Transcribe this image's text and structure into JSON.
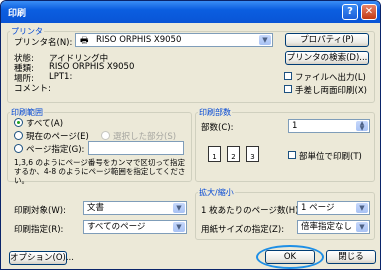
{
  "window": {
    "title": "印刷",
    "help_label": "?",
    "close_label": "✕"
  },
  "printer": {
    "group_label": "プリンタ",
    "name_label": "プリンタ名(N):",
    "name_value": "RISO ORPHIS X9050",
    "properties_button": "プロパティ(P)",
    "find_button": "プリンタの検索(D)...",
    "status_label": "状態:",
    "status_value": "アイドリング中",
    "type_label": "種類:",
    "type_value": "RISO ORPHIS X9050",
    "location_label": "場所:",
    "location_value": "LPT1:",
    "comment_label": "コメント:",
    "comment_value": "",
    "print_to_file_label": "ファイルへ出力(L)",
    "manual_duplex_label": "手差し両面印刷(X)"
  },
  "page_range": {
    "group_label": "印刷範囲",
    "all_label": "すべて(A)",
    "current_label": "現在のページ(E)",
    "selection_label": "選択した部分(S)",
    "pages_label": "ページ指定(G):",
    "pages_value": "",
    "hint": "1,3,6 のようにページ番号をカンマで区切って指定するか、4-8 のようにページ範囲を指定してください。"
  },
  "copies": {
    "group_label": "印刷部数",
    "count_label": "部数(C):",
    "count_value": "1",
    "collate_label": "部単位で印刷(T)",
    "page_icons": [
      "1",
      "2",
      "3"
    ]
  },
  "print_what": {
    "label": "印刷対象(W):",
    "value": "文書"
  },
  "print_pages": {
    "label": "印刷指定(R):",
    "value": "すべてのページ"
  },
  "zoom": {
    "group_label": "拡大/縮小",
    "pages_per_sheet_label": "1 枚あたりのページ数(H):",
    "pages_per_sheet_value": "1 ページ",
    "scale_label": "用紙サイズの指定(Z):",
    "scale_value": "倍率指定なし"
  },
  "footer": {
    "options_button": "オプション(O)...",
    "ok_button": "OK",
    "close_button": "閉じる"
  },
  "colors": {
    "accent": "#0046d5",
    "highlight_ring": "#1e8fe6"
  }
}
